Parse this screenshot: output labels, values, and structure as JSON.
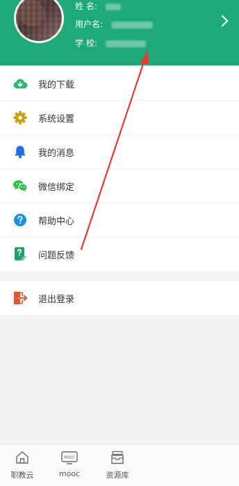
{
  "profile": {
    "name_label": "姓 名:",
    "username_label": "用户名:",
    "school_label": "学 校:"
  },
  "menu": {
    "items": [
      {
        "label": "我的下载",
        "icon": "cloud-download-icon"
      },
      {
        "label": "系统设置",
        "icon": "gear-icon"
      },
      {
        "label": "我的消息",
        "icon": "bell-icon"
      },
      {
        "label": "微信绑定",
        "icon": "wechat-icon"
      },
      {
        "label": "帮助中心",
        "icon": "help-icon"
      },
      {
        "label": "问题反馈",
        "icon": "feedback-icon"
      }
    ],
    "logout_label": "退出登录"
  },
  "tabbar": {
    "tabs": [
      {
        "label": "职教云",
        "icon": "home-icon"
      },
      {
        "label": "mooc",
        "icon": "mooc-icon"
      },
      {
        "label": "资源库",
        "icon": "archive-icon"
      }
    ],
    "mooc_icon_text": "MOOC"
  },
  "colors": {
    "header": "#1fa97a",
    "download": "#2fb573",
    "settings": "#c9a100",
    "messages": "#1f6fe0",
    "wechat": "#2dc14a",
    "help": "#1d8fe0",
    "feedback": "#22a06b",
    "logout": "#e2572e",
    "annotation": "#e53935"
  }
}
